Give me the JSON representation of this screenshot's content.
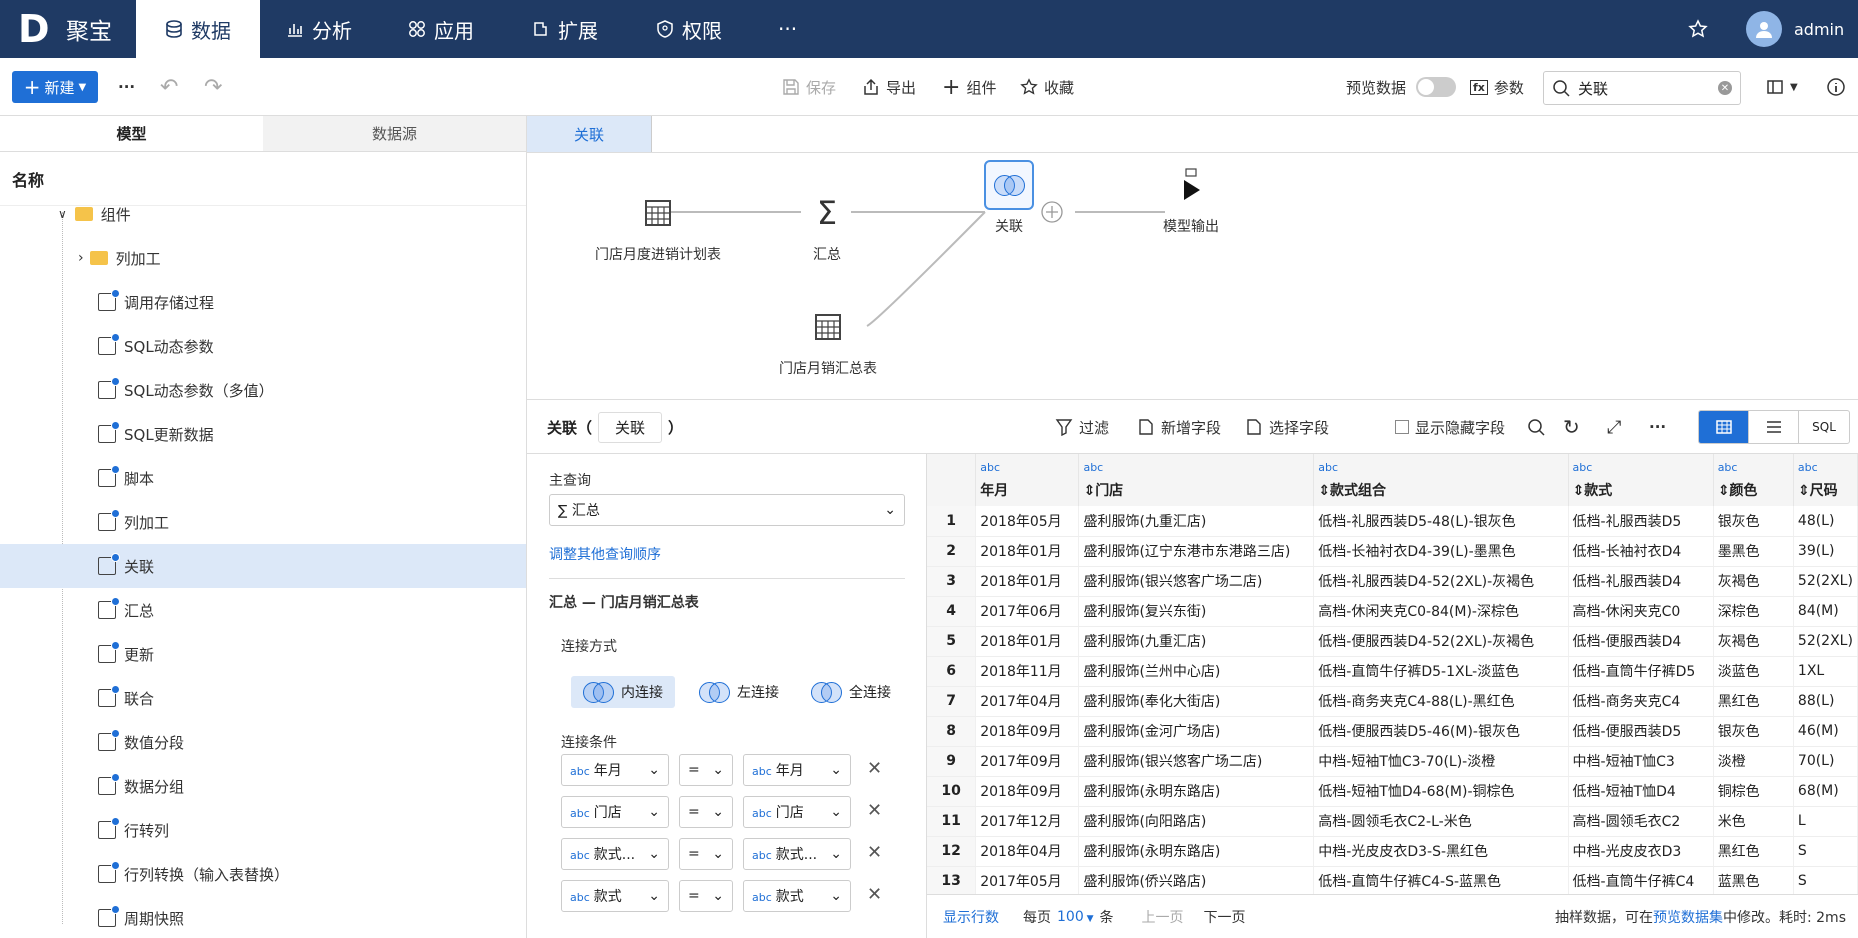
{
  "app": {
    "logo_letter": "D",
    "logo_text": "聚宝",
    "user": "admin"
  },
  "nav": [
    {
      "label": "数据",
      "active": true
    },
    {
      "label": "分析"
    },
    {
      "label": "应用"
    },
    {
      "label": "扩展"
    },
    {
      "label": "权限"
    },
    {
      "label": "···"
    }
  ],
  "toolbar": {
    "new_label": "新建",
    "more": "···",
    "save": "保存",
    "export": "导出",
    "component": "组件",
    "favorite": "收藏",
    "preview_label": "预览数据",
    "params": "参数",
    "search_value": "关联"
  },
  "left": {
    "tabs": [
      "模型",
      "数据源"
    ],
    "header": "名称",
    "tree": [
      {
        "label": "组件",
        "type": "folder",
        "open": true
      },
      {
        "label": "列加工",
        "type": "folder"
      },
      {
        "label": "调用存储过程"
      },
      {
        "label": "SQL动态参数"
      },
      {
        "label": "SQL动态参数（多值）"
      },
      {
        "label": "SQL更新数据"
      },
      {
        "label": "脚本"
      },
      {
        "label": "列加工"
      },
      {
        "label": "关联",
        "selected": true
      },
      {
        "label": "汇总"
      },
      {
        "label": "更新"
      },
      {
        "label": "联合"
      },
      {
        "label": "数值分段"
      },
      {
        "label": "数据分组"
      },
      {
        "label": "行转列"
      },
      {
        "label": "行列转换（输入表替换）"
      },
      {
        "label": "周期快照"
      }
    ]
  },
  "graph": {
    "tab": "关联",
    "nodes": {
      "n1": "门店月度进销计划表",
      "n2": "汇总",
      "n3": "关联",
      "n4": "模型输出",
      "n5": "门店月销汇总表"
    }
  },
  "join": {
    "title": "关联（",
    "pill": "关联",
    "close": "）",
    "filter": "过滤",
    "add_field": "新增字段",
    "select_field": "选择字段",
    "show_hidden": "显示隐藏字段",
    "sql": "SQL"
  },
  "cfg": {
    "main_query_label": "主查询",
    "main_query": "汇总",
    "adjust": "调整其他查询顺序",
    "section": "汇总 — 门店月销汇总表",
    "join_type_label": "连接方式",
    "join_types": [
      "内连接",
      "左连接",
      "全连接"
    ],
    "cond_label": "连接条件",
    "conds": [
      {
        "l": "年月",
        "op": "=",
        "r": "年月"
      },
      {
        "l": "门店",
        "op": "=",
        "r": "门店"
      },
      {
        "l": "款式...",
        "op": "=",
        "r": "款式..."
      },
      {
        "l": "款式",
        "op": "=",
        "r": "款式"
      }
    ],
    "abc": "abc"
  },
  "table": {
    "type_tag": "abc",
    "columns": [
      "年月",
      "门店",
      "款式组合",
      "款式",
      "颜色",
      "尺码"
    ],
    "rows": [
      [
        "1",
        "2018年05月",
        "盛利服饰(九重汇店)",
        "低档-礼服西装D5-48(L)-银灰色",
        "低档-礼服西装D5",
        "银灰色",
        "48(L)"
      ],
      [
        "2",
        "2018年01月",
        "盛利服饰(辽宁东港市东港路三店)",
        "低档-长袖衬衣D4-39(L)-墨黑色",
        "低档-长袖衬衣D4",
        "墨黑色",
        "39(L)"
      ],
      [
        "3",
        "2018年01月",
        "盛利服饰(银兴悠客广场二店)",
        "低档-礼服西装D4-52(2XL)-灰褐色",
        "低档-礼服西装D4",
        "灰褐色",
        "52(2XL)"
      ],
      [
        "4",
        "2017年06月",
        "盛利服饰(复兴东街)",
        "高档-休闲夹克C0-84(M)-深棕色",
        "高档-休闲夹克C0",
        "深棕色",
        "84(M)"
      ],
      [
        "5",
        "2018年01月",
        "盛利服饰(九重汇店)",
        "低档-便服西装D4-52(2XL)-灰褐色",
        "低档-便服西装D4",
        "灰褐色",
        "52(2XL)"
      ],
      [
        "6",
        "2018年11月",
        "盛利服饰(兰州中心店)",
        "低档-直筒牛仔裤D5-1XL-淡蓝色",
        "低档-直筒牛仔裤D5",
        "淡蓝色",
        "1XL"
      ],
      [
        "7",
        "2017年04月",
        "盛利服饰(奉化大街店)",
        "低档-商务夹克C4-88(L)-黑红色",
        "低档-商务夹克C4",
        "黑红色",
        "88(L)"
      ],
      [
        "8",
        "2018年09月",
        "盛利服饰(金河广场店)",
        "低档-便服西装D5-46(M)-银灰色",
        "低档-便服西装D5",
        "银灰色",
        "46(M)"
      ],
      [
        "9",
        "2017年09月",
        "盛利服饰(银兴悠客广场二店)",
        "中档-短袖T恤C3-70(L)-淡橙",
        "中档-短袖T恤C3",
        "淡橙",
        "70(L)"
      ],
      [
        "10",
        "2018年09月",
        "盛利服饰(永明东路店)",
        "低档-短袖T恤D4-68(M)-铜棕色",
        "低档-短袖T恤D4",
        "铜棕色",
        "68(M)"
      ],
      [
        "11",
        "2017年12月",
        "盛利服饰(向阳路店)",
        "高档-圆领毛衣C2-L-米色",
        "高档-圆领毛衣C2",
        "米色",
        "L"
      ],
      [
        "12",
        "2018年04月",
        "盛利服饰(永明东路店)",
        "中档-光皮皮衣D3-S-黑红色",
        "中档-光皮皮衣D3",
        "黑红色",
        "S"
      ],
      [
        "13",
        "2017年05月",
        "盛利服饰(侨兴路店)",
        "低档-直筒牛仔裤C4-S-蓝黑色",
        "低档-直筒牛仔裤C4",
        "蓝黑色",
        "S"
      ]
    ]
  },
  "footer": {
    "show_rows": "显示行数",
    "per_page": "每页",
    "page_size": "100",
    "unit": "条",
    "prev": "上一页",
    "next": "下一页",
    "note_a": "抽样数据，可在",
    "note_link": "预览数据集",
    "note_b": "中修改。耗时: 2ms"
  },
  "colors": {
    "topbar": "#1f3a64",
    "accent": "#1f6fd6",
    "selected": "#dce8f8"
  }
}
